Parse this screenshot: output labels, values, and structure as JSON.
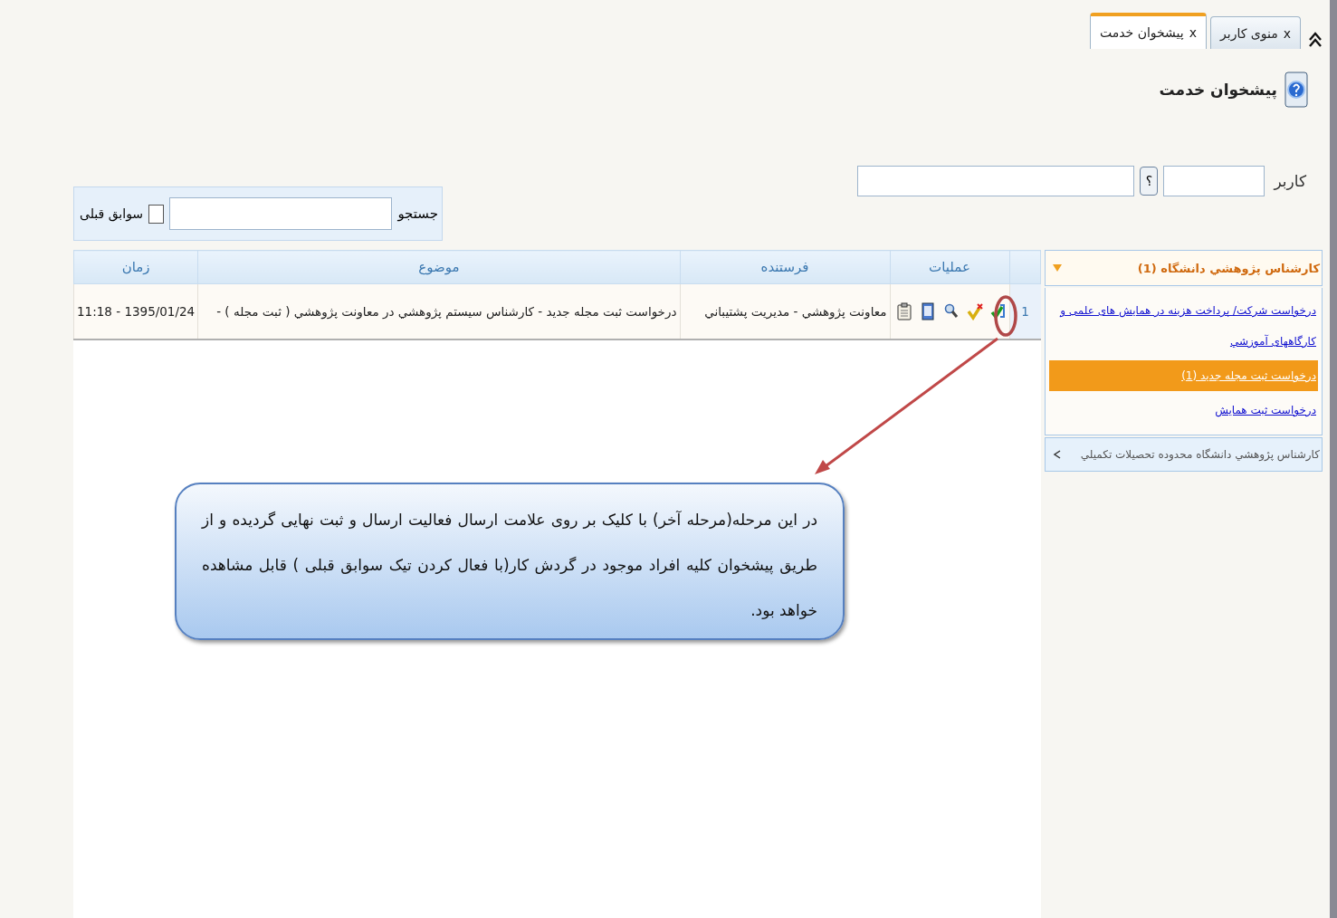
{
  "tabs": [
    {
      "label": "منوی کاربر",
      "close": "x",
      "selected": false
    },
    {
      "label": "پیشخوان خدمت",
      "close": "x",
      "selected": true
    }
  ],
  "page_title": "پیشخوان خدمت",
  "user_filter": {
    "label": "کاربر",
    "help": "؟"
  },
  "search": {
    "label": "جستجو",
    "history": {
      "label": "سوابق قبلی",
      "checked": false
    }
  },
  "table": {
    "columns": [
      "عملیات",
      "فرستنده",
      "موضوع",
      "زمان"
    ],
    "rows": [
      {
        "index": "1",
        "sender": "معاونت پژوهشي - مدیریت پشتیباني",
        "subject": "درخواست ثبت مجله جدید - کارشناس سیستم پژوهشي در معاونت پژوهشي ( ثبت مجله ) -",
        "time": "1395/01/24 - 11:18"
      }
    ]
  },
  "sidebar": [
    {
      "title": "کارشناس پژوهشي دانشگاه (1)",
      "expanded": true,
      "items": [
        {
          "label": "درخواست شرکت/ پرداخت هزینه در همایش های علمی و",
          "selected": false
        },
        {
          "label": "کارگاههای آموزشي",
          "selected": false
        },
        {
          "label": "درخواست ثبت مجله جدید (1)",
          "selected": true
        },
        {
          "label": "درخواست ثبت همایش",
          "selected": false
        }
      ]
    },
    {
      "title": "کارشناس پژوهشي دانشگاه محدوده تحصیلات تکمیلي",
      "expanded": false
    }
  ],
  "callout": "در این مرحله(مرحله آخر) با کلیک بر روی علامت ارسال فعالیت ارسال و ثبت نهایی گردیده و از طریق پیشخوان کلیه افراد موجود در گردش کار(با فعال کردن تیک سوابق قبلی ) قابل مشاهده خواهد بود."
}
